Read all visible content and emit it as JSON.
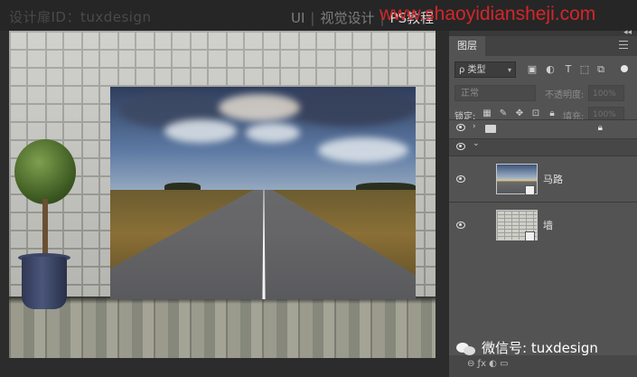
{
  "header": {
    "brand": "设计扉ID：tuxdesign",
    "nav_ui": "UI",
    "nav_sep": "|",
    "nav_visual": "视觉设计",
    "nav_ps": "PS教程",
    "url": "www.shaoyidiansheji.com"
  },
  "layers_panel": {
    "tab_label": "图层",
    "filter_label": "ρ 类型",
    "blend_mode": "正常",
    "opacity_label": "不透明度:",
    "opacity_value": "100%",
    "lock_label": "锁定:",
    "fill_label": "填充:",
    "fill_value": "100%",
    "layers": [
      {
        "name": "马路",
        "thumb": "road"
      },
      {
        "name": "墙",
        "thumb": "wall"
      }
    ]
  },
  "watermark": {
    "text": "微信号: tuxdesign"
  },
  "colors": {
    "url_red": "#d3262b",
    "panel_bg": "#535353"
  }
}
